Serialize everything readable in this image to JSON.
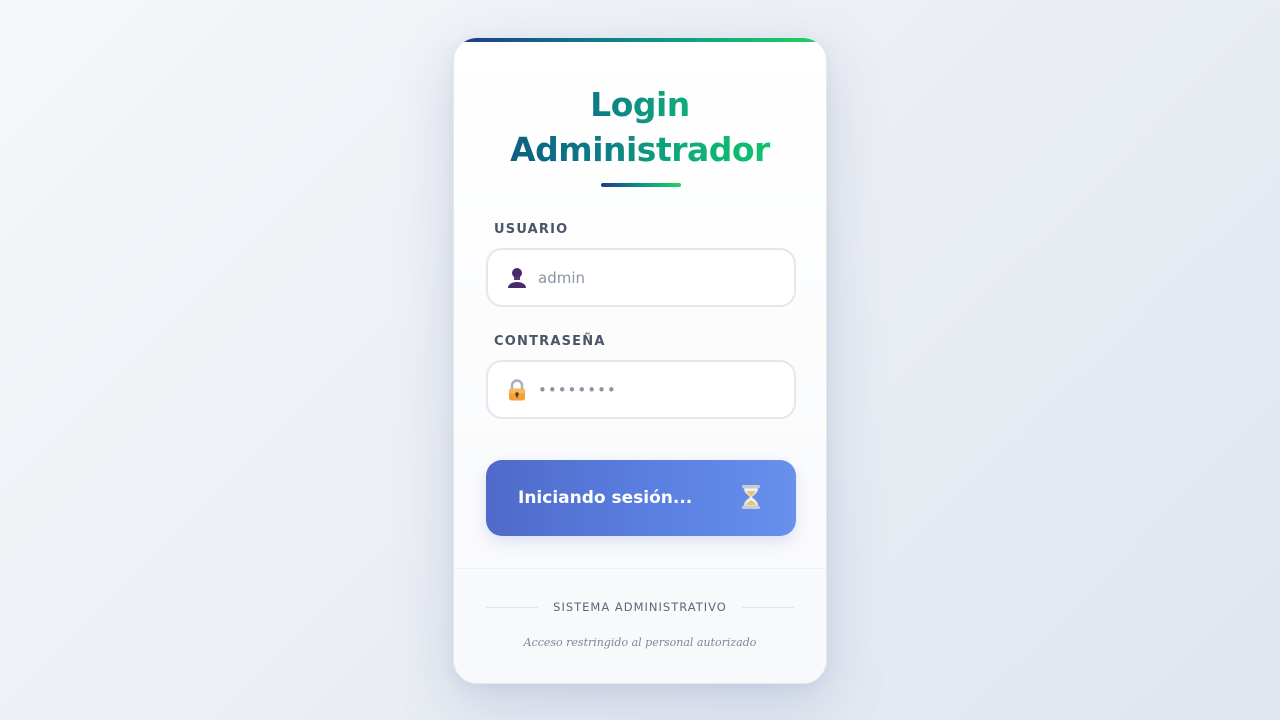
{
  "login": {
    "title_line1": "Login",
    "title_line2": "Administrador",
    "username": {
      "label": "USUARIO",
      "placeholder": "admin",
      "icon": "user-icon"
    },
    "password": {
      "label": "CONTRASEÑA",
      "value": "••••••••",
      "icon": "lock-icon"
    },
    "submit": {
      "label": "Iniciando sesión...",
      "icon": "hourglass-icon"
    }
  },
  "footer": {
    "system_label": "SISTEMA ADMINISTRATIVO",
    "note": "Acceso restringido al personal autorizado"
  },
  "colors": {
    "accent_blue": "#1e3a8a",
    "accent_teal": "#0d9488",
    "accent_green": "#22d35e",
    "button_start": "#4f6ac8",
    "button_end": "#6890ec"
  }
}
